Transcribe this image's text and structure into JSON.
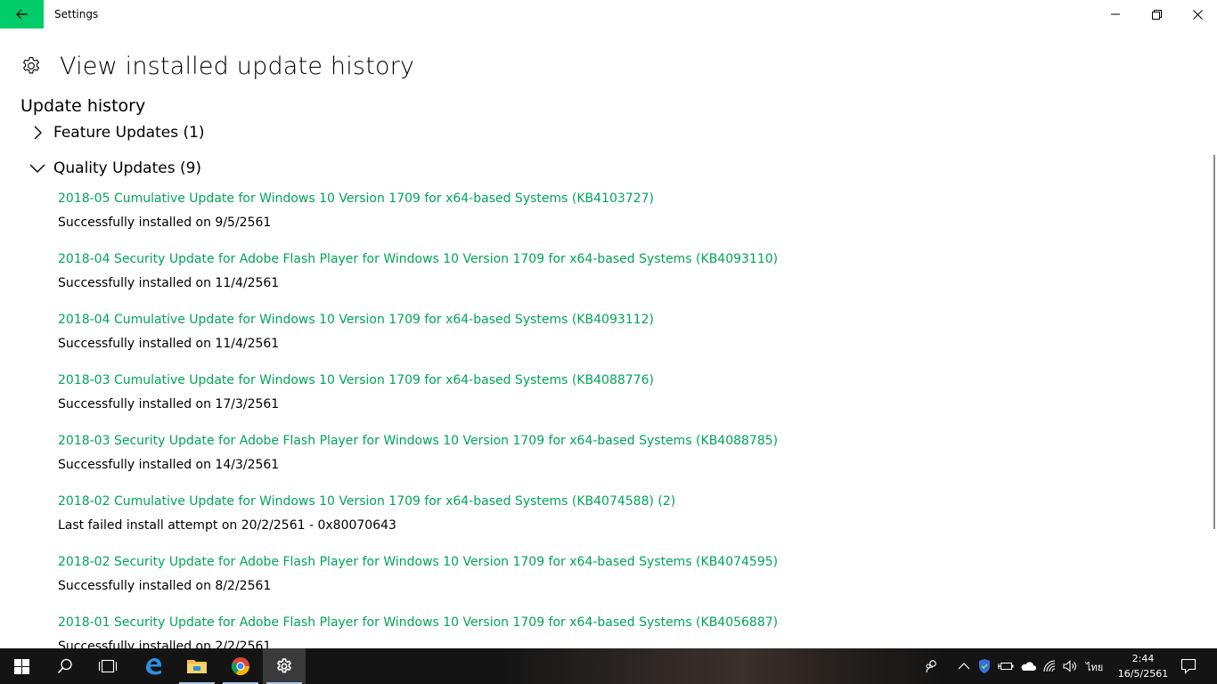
{
  "window": {
    "title": "Settings"
  },
  "page": {
    "title": "View installed update history",
    "section_title": "Update history"
  },
  "groups": {
    "feature": {
      "label": "Feature Updates (1)",
      "expanded": false
    },
    "quality": {
      "label": "Quality Updates (9)",
      "expanded": true
    }
  },
  "updates": [
    {
      "title": "2018-05 Cumulative Update for Windows 10 Version 1709 for x64-based Systems (KB4103727)",
      "status": "Successfully installed on 9/5/2561"
    },
    {
      "title": "2018-04 Security Update for Adobe Flash Player for Windows 10 Version 1709 for x64-based Systems (KB4093110)",
      "status": "Successfully installed on 11/4/2561"
    },
    {
      "title": "2018-04 Cumulative Update for Windows 10 Version 1709 for x64-based Systems (KB4093112)",
      "status": "Successfully installed on 11/4/2561"
    },
    {
      "title": "2018-03 Cumulative Update for Windows 10 Version 1709 for x64-based Systems (KB4088776)",
      "status": "Successfully installed on 17/3/2561"
    },
    {
      "title": "2018-03 Security Update for Adobe Flash Player for Windows 10 Version 1709 for x64-based Systems (KB4088785)",
      "status": "Successfully installed on 14/3/2561"
    },
    {
      "title": "2018-02 Cumulative Update for Windows 10 Version 1709 for x64-based Systems (KB4074588) (2)",
      "status": "Last failed install attempt on 20/2/2561 - 0x80070643"
    },
    {
      "title": "2018-02 Security Update for Adobe Flash Player for Windows 10 Version 1709 for x64-based Systems (KB4074595)",
      "status": "Successfully installed on 8/2/2561"
    },
    {
      "title": "2018-01 Security Update for Adobe Flash Player for Windows 10 Version 1709 for x64-based Systems (KB4056887)",
      "status": "Successfully installed on 2/2/2561"
    }
  ],
  "taskbar": {
    "pinned": [
      "windows-start-icon",
      "search-icon",
      "task-view-icon",
      "edge-icon",
      "file-explorer-icon",
      "chrome-icon",
      "settings-icon"
    ],
    "tray": {
      "language": "ไทย",
      "time": "2:44",
      "date": "16/5/2561"
    }
  },
  "colors": {
    "accent": "#00cc6a",
    "link": "#00a558",
    "taskbar": "#141414"
  }
}
